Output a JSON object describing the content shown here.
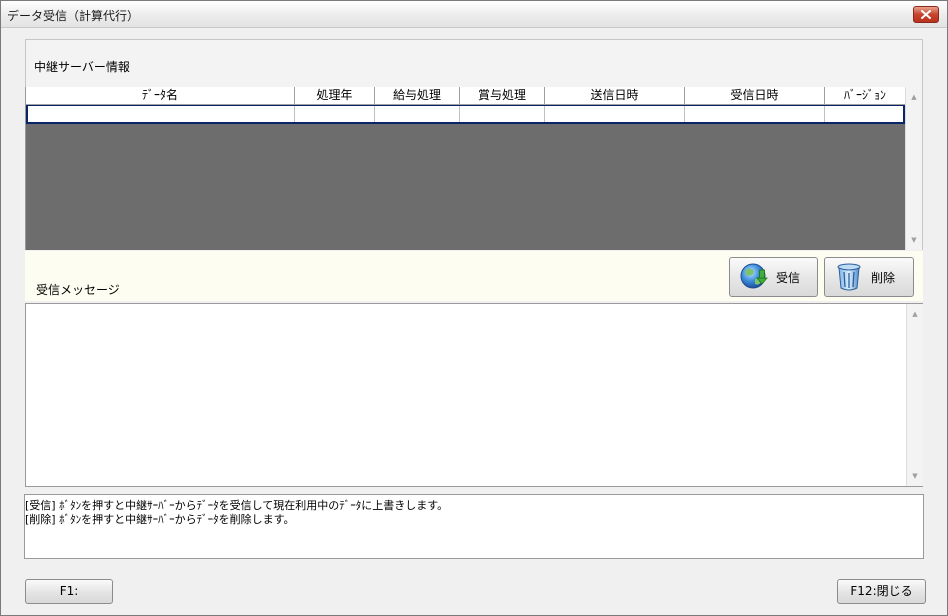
{
  "window": {
    "title": "データ受信（計算代行）"
  },
  "server_section": {
    "label": "中継サーバー情報",
    "columns": [
      "ﾃﾞｰﾀ名",
      "処理年",
      "給与処理",
      "賞与処理",
      "送信日時",
      "受信日時",
      "ﾊﾞｰｼﾞｮﾝ"
    ],
    "rows": [
      [
        "",
        "",
        "",
        "",
        "",
        "",
        ""
      ]
    ]
  },
  "message_section": {
    "label": "受信メッセージ",
    "text": ""
  },
  "toolbar": {
    "receive_label": "受信",
    "delete_label": "削除"
  },
  "help": {
    "line1": "[受信] ﾎﾞﾀﾝを押すと中継ｻｰﾊﾞｰからﾃﾞｰﾀを受信して現在利用中のﾃﾞｰﾀに上書きします。",
    "line2": "[削除] ﾎﾞﾀﾝを押すと中継ｻｰﾊﾞｰからﾃﾞｰﾀを削除します。"
  },
  "footer": {
    "f1_label": "F1:",
    "f12_label": "F12:閉じる"
  },
  "icons": {
    "close": "close-icon",
    "receive": "globe-download-icon",
    "delete": "trash-icon"
  },
  "colors": {
    "grid_bg": "#6d6d6d",
    "selection_border": "#0a246a",
    "message_band": "#fdfdf1",
    "close_button": "#c8442c"
  }
}
